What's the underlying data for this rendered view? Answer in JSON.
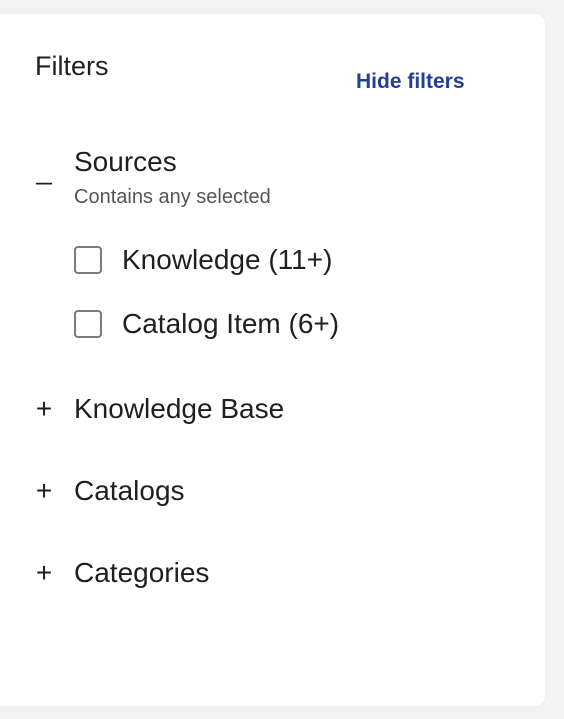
{
  "header": {
    "title": "Filters",
    "hide_filters_label": "Hide filters"
  },
  "sources": {
    "toggle": "_",
    "title": "Sources",
    "subtitle": "Contains any selected",
    "options": [
      {
        "label": "Knowledge (11+)",
        "checked": false
      },
      {
        "label": "Catalog Item (6+)",
        "checked": false
      }
    ]
  },
  "collapsed_groups": [
    {
      "toggle": "+",
      "title": "Knowledge Base"
    },
    {
      "toggle": "+",
      "title": "Catalogs"
    },
    {
      "toggle": "+",
      "title": "Categories"
    }
  ],
  "colors": {
    "accent": "#23408f",
    "text": "#1f1f1f",
    "muted": "#555555",
    "checkbox_border": "#7a7a7a"
  }
}
